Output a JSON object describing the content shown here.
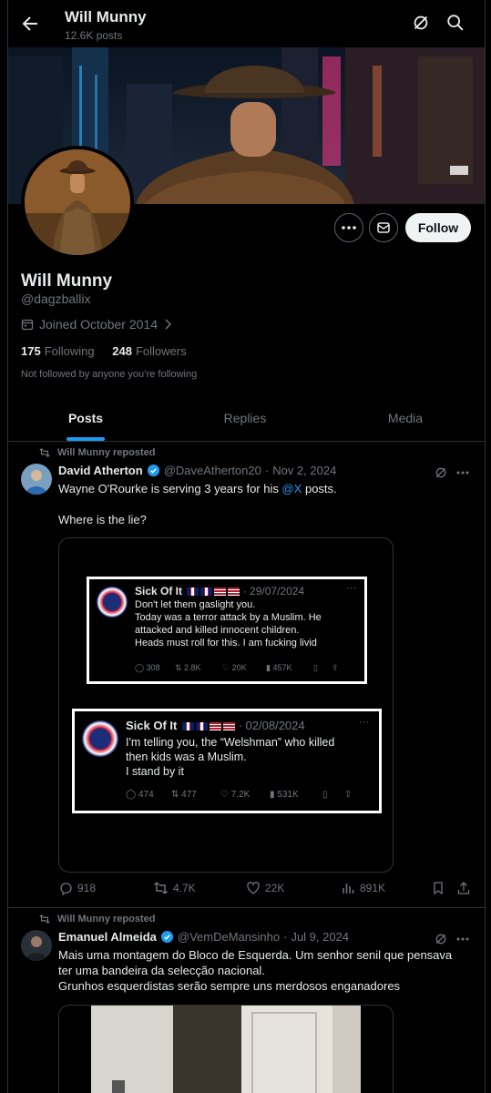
{
  "header": {
    "title": "Will Munny",
    "post_count": "12.6K posts"
  },
  "profile": {
    "name": "Will Munny",
    "handle": "@dagzballix",
    "joined": "Joined October 2014",
    "following_count": "175",
    "following_label": "Following",
    "followers_count": "248",
    "followers_label": "Followers",
    "not_followed": "Not followed by anyone you’re following",
    "follow_label": "Follow"
  },
  "tabs": [
    {
      "label": "Posts"
    },
    {
      "label": "Replies"
    },
    {
      "label": "Media"
    }
  ],
  "posts": [
    {
      "repost_text": "Will Munny reposted",
      "name": "David Atherton",
      "handle": "@DaveAtherton20",
      "date": "Nov 2, 2024",
      "text_before": "Wayne O'Rourke is serving 3 years for his ",
      "text_link": "@X",
      "text_after": " posts.\n\nWhere is the lie?",
      "quoted": [
        {
          "name": "Sick Of It",
          "date": "· 29/07/2024",
          "body": "Don't let them gaslight you.\nToday was a terror attack by a Muslim. He\nattacked and killed innocent children.\nHeads must roll for this. I am fucking livid",
          "replies": "308",
          "reposts": "2.8K",
          "likes": "20K",
          "views": "457K"
        },
        {
          "name": "Sick Of It",
          "date": "· 02/08/2024",
          "body": "I'm telling you, the “Welshman” who killed\nthen kids was a Muslim.\nI stand by it",
          "replies": "474",
          "reposts": "477",
          "likes": "7.2K",
          "views": "531K"
        }
      ],
      "replies": "918",
      "reposts": "4.7K",
      "likes": "22K",
      "views": "891K"
    },
    {
      "repost_text": "Will Munny reposted",
      "name": "Emanuel Almeida",
      "handle": "@VemDeMansinho",
      "date": "Jul 9, 2024",
      "text": "Mais uma montagem do Bloco de Esquerda. Um senhor senil que pensava\nter uma bandeira da selecção nacional.\nGrunhos esquerdistas serão sempre uns merdosos enganadores"
    }
  ],
  "colors": {
    "accent": "#1d9bf0",
    "background": "#000000",
    "text": "#e7e9ea",
    "muted": "#71767b",
    "border": "#2f3336"
  }
}
